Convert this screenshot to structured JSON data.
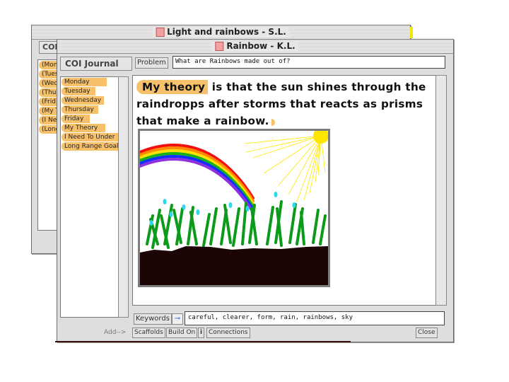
{
  "back_window": {
    "title": "Light and  rainbows - S.L.",
    "panel_label": "COI",
    "items": [
      "(Mon",
      "(Tues",
      "(Wed",
      "(Thur",
      "(Frid",
      "(My T",
      "(I Nee",
      "(Long"
    ]
  },
  "front_window": {
    "title": "Rainbow - K.L.",
    "sidebar_heading": "COI Journal",
    "journal_items": [
      "Monday",
      "Tuesday",
      "Wednesday",
      "Thursday",
      "Friday",
      "My Theory",
      "I Need To Under",
      "Long Range Goal"
    ],
    "problem_label": "Problem",
    "problem_text": "What are Rainbows made out of?",
    "theory_tag": "My theory",
    "theory_text": " is that the sun shines through  the raindropps after storms that reacts as prisms that make a rainbow.",
    "keywords_label": "Keywords",
    "keywords_value": "careful, clearer, form, rain, rainbows, sky",
    "buttons": {
      "add": "Add-->",
      "scaffolds": "Scaffolds",
      "build_on": "Build On",
      "info": "i",
      "connections": "Connections",
      "close": "Close"
    }
  },
  "drawing": {
    "sky_color": "#ffffff",
    "ground_color": "#1c0404",
    "sun_color": "#ffe600",
    "grass_color": "#0c9a1a",
    "drop_color": "#2fd6f0",
    "rainbow_colors": [
      "#f01010",
      "#ff8a00",
      "#ffe000",
      "#18b018",
      "#1030ff",
      "#8c30e0"
    ]
  },
  "colors": {
    "tag_orange": "#f7c16b",
    "window_bg": "#dedede"
  }
}
